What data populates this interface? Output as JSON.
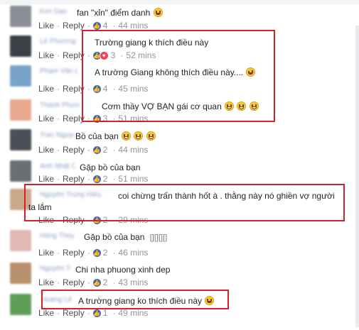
{
  "actions": {
    "like": "Like",
    "reply": "Reply",
    "sep": "·"
  },
  "comments": [
    {
      "name": "Kim Dạo",
      "text": "fan \"xỉn\" điểm danh",
      "emoji": [
        "smile"
      ],
      "count": "4",
      "time": "44 mins",
      "reactions": [
        "like"
      ]
    },
    {
      "name": "Lê Phương Linh",
      "text": "Trường giang k thích điều này",
      "emoji": [],
      "count": "3",
      "time": "52 mins",
      "reactions": [
        "like",
        "love"
      ]
    },
    {
      "name": "Phạm Văn Long",
      "text": "A trường Giang không thích điều này....",
      "emoji": [
        "sweat"
      ],
      "count": "4",
      "time": "45 mins",
      "reactions": [
        "like"
      ]
    },
    {
      "name": "Thanh Phương",
      "text": "Cơm thầy VỢ BẠN gái cơ quan",
      "emoji": [
        "lol",
        "lol",
        "lol"
      ],
      "count": "3",
      "time": "51 mins",
      "reactions": [
        "like"
      ]
    },
    {
      "name": "Tran Nguyen",
      "text": "Bồ của bạn",
      "emoji": [
        "lol",
        "lol",
        "lol"
      ],
      "count": "2",
      "time": "44 mins",
      "reactions": [
        "like"
      ]
    },
    {
      "name": "Anh Nhật Ca Chi",
      "text": "Gặp bồ của bạn",
      "emoji": [],
      "count": "2",
      "time": "51 mins",
      "reactions": [
        "like"
      ]
    },
    {
      "name": "Nguyễn Trung Hiếu",
      "text": "coi chừng trấn thành hốt à . thằng này nó ghiền vợ người ta lắm",
      "emoji": [],
      "count": "2",
      "time": "29 mins",
      "reactions": [
        "like"
      ]
    },
    {
      "name": "Hồng Thúy",
      "text": "Gặp bồ của bạn",
      "extra": "[][][][]",
      "emoji": [],
      "count": "2",
      "time": "46 mins",
      "reactions": [
        "like"
      ]
    },
    {
      "name": "Nguyễn Thảo",
      "text": "Chi nha phuong xinh dep",
      "emoji": [],
      "count": "2",
      "time": "43 mins",
      "reactions": [
        "like"
      ]
    },
    {
      "name": "Hoàng Lê",
      "text": "A trường giang ko thích điều này",
      "emoji": [
        "smile"
      ],
      "count": "1",
      "time": "49 mins",
      "reactions": [
        "like"
      ]
    }
  ],
  "colors": {
    "highlight": "#d7212a",
    "like": "#4267b2",
    "love": "#f33e58",
    "meta": "#90949c"
  }
}
